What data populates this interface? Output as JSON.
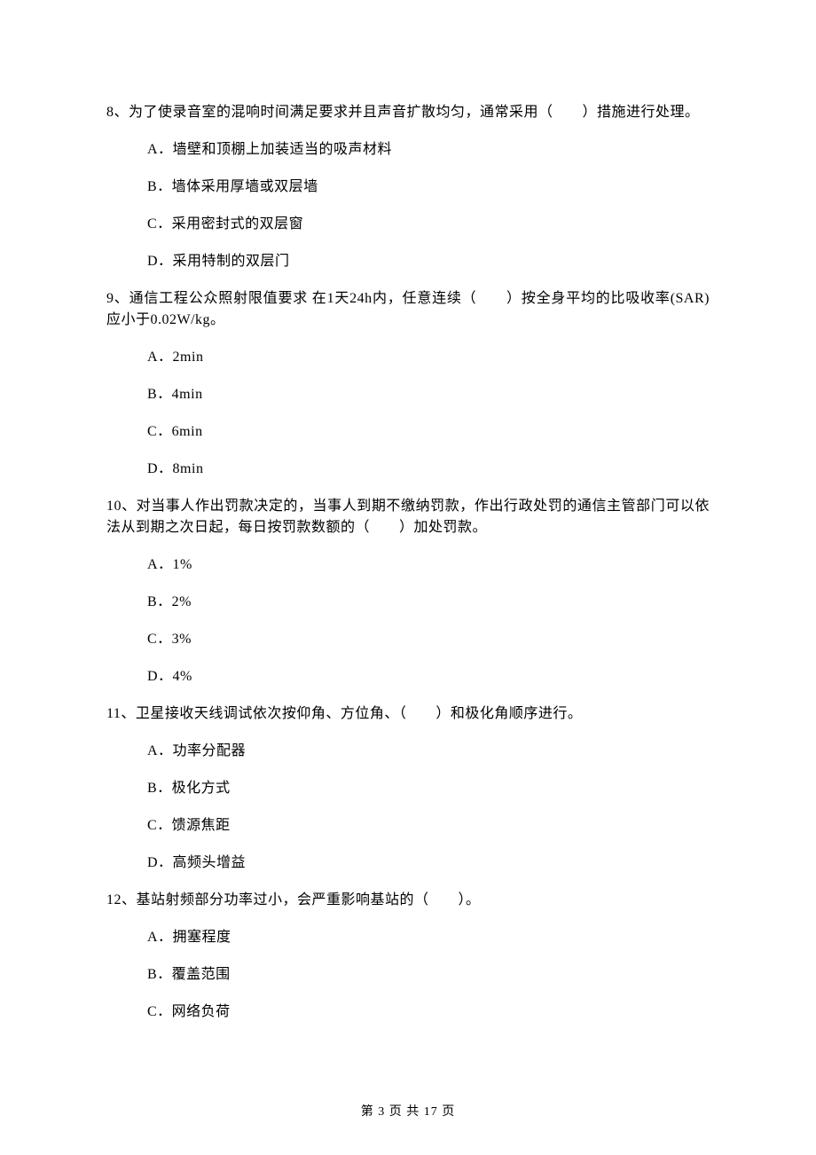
{
  "questions": [
    {
      "stem": "8、为了使录音室的混响时间满足要求并且声音扩散均匀，通常采用（　　）措施进行处理。",
      "options": [
        "A．墙壁和顶棚上加装适当的吸声材料",
        "B．墙体采用厚墙或双层墙",
        "C．采用密封式的双层窗",
        "D．采用特制的双层门"
      ]
    },
    {
      "stem": "9、通信工程公众照射限值要求 在1天24h内，任意连续（　　）按全身平均的比吸收率(SAR)应小于0.02W/kg。",
      "options": [
        "A．2min",
        "B．4min",
        "C．6min",
        "D．8min"
      ]
    },
    {
      "stem": "10、对当事人作出罚款决定的，当事人到期不缴纳罚款，作出行政处罚的通信主管部门可以依法从到期之次日起，每日按罚款数额的（　　）加处罚款。",
      "options": [
        "A．1%",
        "B．2%",
        "C．3%",
        "D．4%"
      ]
    },
    {
      "stem": "11、卫星接收天线调试依次按仰角、方位角、（　　）和极化角顺序进行。",
      "options": [
        "A．功率分配器",
        "B．极化方式",
        "C．馈源焦距",
        "D．高频头增益"
      ]
    },
    {
      "stem": "12、基站射频部分功率过小，会严重影响基站的（　　）。",
      "options": [
        "A．拥塞程度",
        "B．覆盖范围",
        "C．网络负荷"
      ]
    }
  ],
  "footer": "第 3 页 共 17 页"
}
